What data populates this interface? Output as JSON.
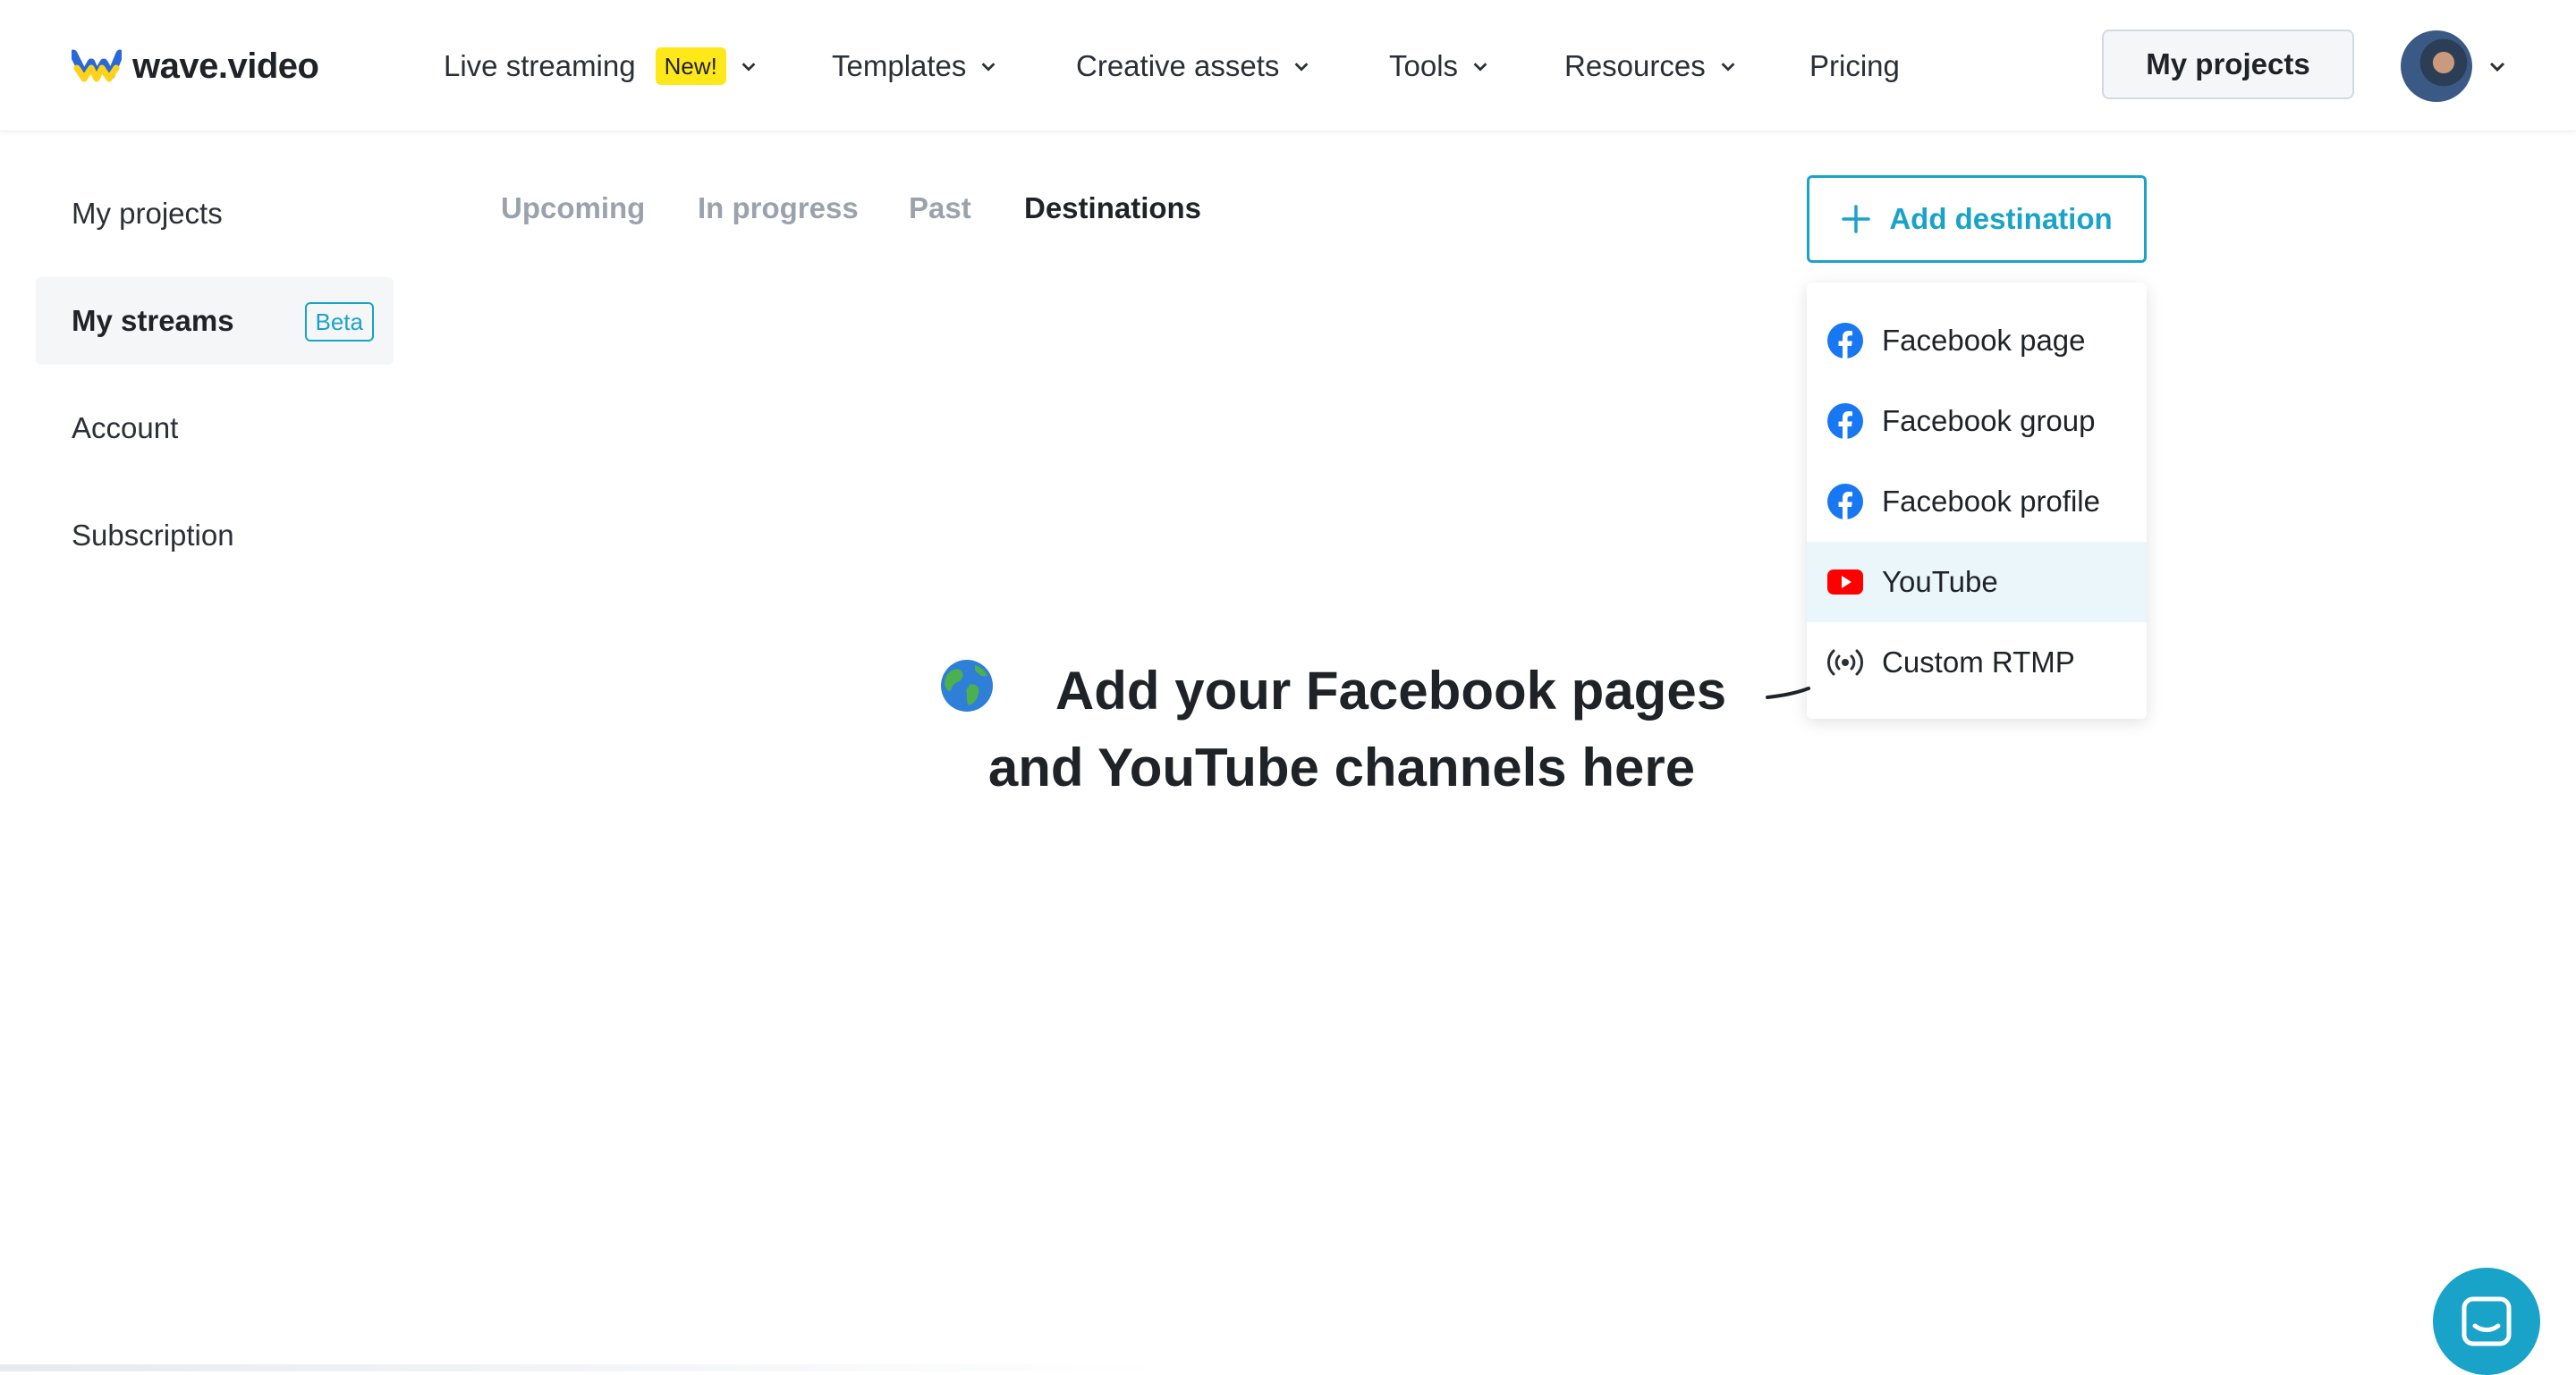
{
  "brand": {
    "name": "wave.video"
  },
  "nav": {
    "items": [
      {
        "label": "Live streaming",
        "badge": "New!"
      },
      {
        "label": "Templates"
      },
      {
        "label": "Creative assets"
      },
      {
        "label": "Tools"
      },
      {
        "label": "Resources"
      },
      {
        "label": "Pricing"
      }
    ],
    "my_projects_button": "My projects"
  },
  "sidebar": {
    "items": [
      {
        "label": "My projects"
      },
      {
        "label": "My streams",
        "badge": "Beta",
        "active": true
      },
      {
        "label": "Account"
      },
      {
        "label": "Subscription"
      }
    ]
  },
  "tabs": [
    {
      "label": "Upcoming"
    },
    {
      "label": "In progress"
    },
    {
      "label": "Past"
    },
    {
      "label": "Destinations",
      "active": true
    }
  ],
  "add_destination": {
    "button_label": "Add destination",
    "options": [
      {
        "label": "Facebook page",
        "icon": "facebook-icon"
      },
      {
        "label": "Facebook group",
        "icon": "facebook-icon"
      },
      {
        "label": "Facebook profile",
        "icon": "facebook-icon"
      },
      {
        "label": "YouTube",
        "icon": "youtube-icon",
        "highlighted": true
      },
      {
        "label": "Custom RTMP",
        "icon": "broadcast-icon"
      }
    ]
  },
  "empty_state": {
    "line1": "Add your Facebook pages",
    "line2": "and YouTube channels here"
  },
  "colors": {
    "accent": "#1aa3c8",
    "badge_new": "#ffe81a",
    "facebook": "#1877f2",
    "youtube": "#ff0000"
  }
}
